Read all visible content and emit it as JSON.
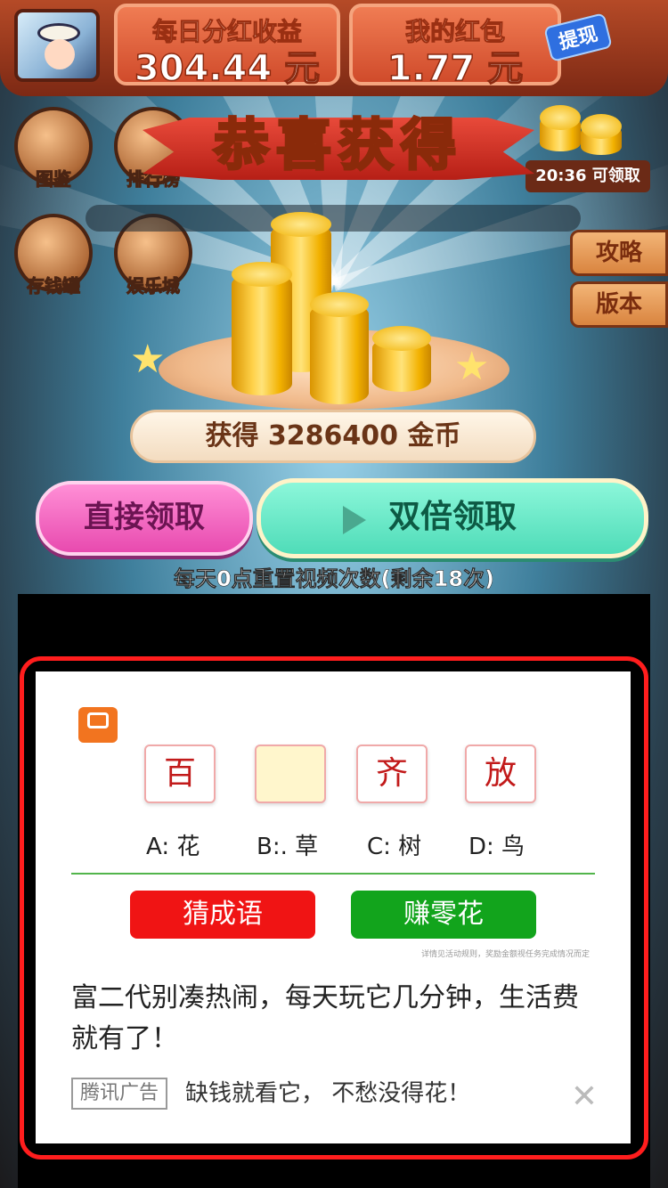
{
  "header": {
    "daily_dividend_label": "每日分红收益",
    "daily_dividend_value": "304.44 元",
    "red_packet_label": "我的红包",
    "red_packet_value": "1.77 元",
    "withdraw_label": "提现"
  },
  "menu": {
    "catalog": "图鉴",
    "ranking": "排行榜",
    "piggy_bank": "存钱罐",
    "entertainment": "娱乐城",
    "claim_timer": "20:36 可领取",
    "guide": "攻略",
    "version": "版本"
  },
  "popup": {
    "title": "恭喜获得",
    "reward_text": "获得 3286400 金币",
    "direct_claim": "直接领取",
    "double_claim": "双倍领取",
    "reset_notice": "每天0点重置视频次数(剩余18次)"
  },
  "ad": {
    "idiom_chars": [
      "百",
      "",
      "齐",
      "放"
    ],
    "options": [
      "A: 花",
      "B:. 草",
      "C: 树",
      "D: 鸟"
    ],
    "guess_button": "猜成语",
    "earn_button": "赚零花",
    "fine_print": "详情见活动规则，奖励金额视任务完成情况而定",
    "headline": "富二代别凑热闹，每天玩它几分钟，生活费就有了！",
    "tag": "腾讯广告",
    "subtitle": "缺钱就看它， 不愁没得花！",
    "colors": {
      "red": "#f01414",
      "green": "#12a41c"
    }
  }
}
